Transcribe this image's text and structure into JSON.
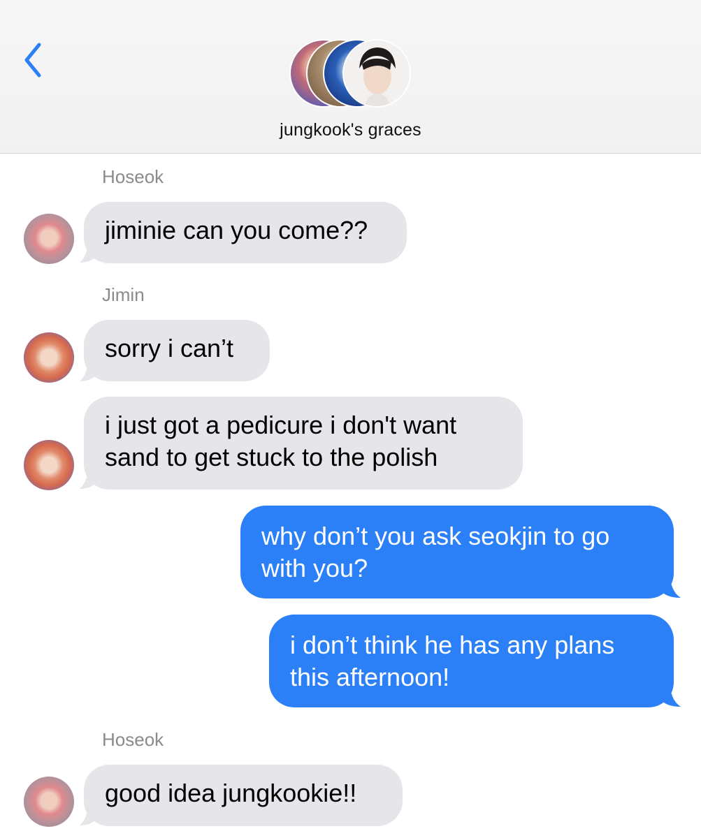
{
  "header": {
    "title": "jungkook's graces",
    "back_icon": "chevron-left-icon",
    "accent_color": "#2c80f7"
  },
  "messages": [
    {
      "sender": "Hoseok",
      "text": "jiminie can you come??",
      "direction": "incoming"
    },
    {
      "sender": "Jimin",
      "text": "sorry i can’t",
      "direction": "incoming"
    },
    {
      "sender": "Jimin",
      "lines": [
        "i just got a pedicure i don't want",
        "sand to get stuck to the polish"
      ],
      "direction": "incoming"
    },
    {
      "lines": [
        "why don’t you ask seokjin to go",
        "with you?"
      ],
      "direction": "outgoing"
    },
    {
      "lines": [
        "i don’t think he has any plans",
        "this afternoon!"
      ],
      "direction": "outgoing"
    },
    {
      "sender": "Hoseok",
      "text": "good idea jungkookie!!",
      "direction": "incoming"
    }
  ],
  "colors": {
    "incoming_bubble": "#e5e5ea",
    "outgoing_bubble": "#2c80f7",
    "sender_label": "#8a8a8e"
  }
}
